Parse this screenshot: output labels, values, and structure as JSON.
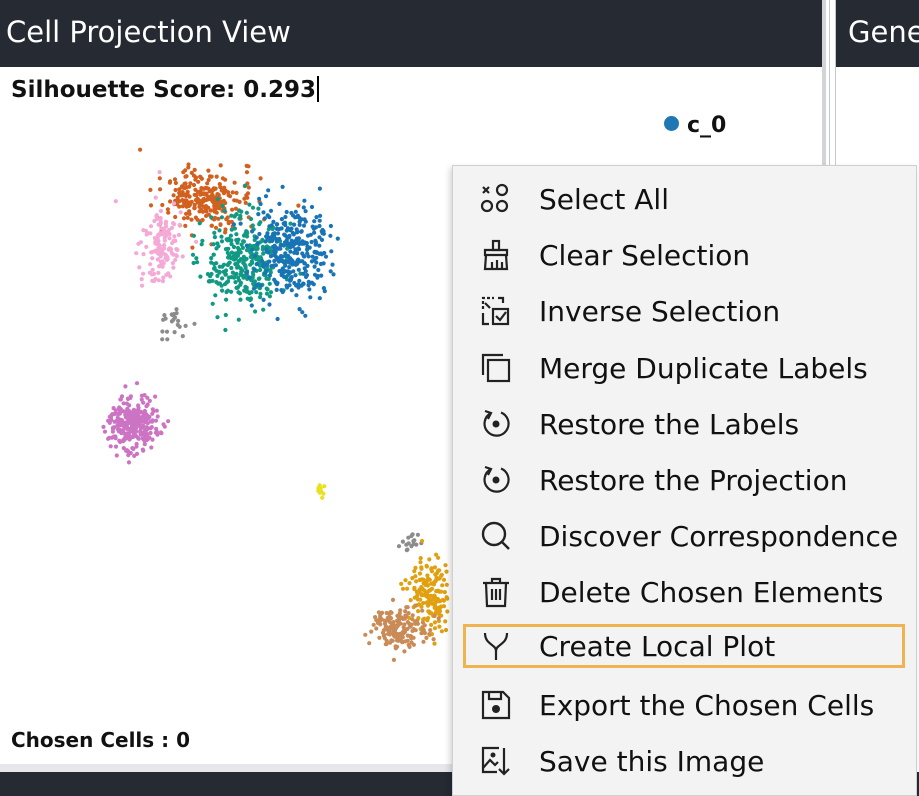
{
  "panels": {
    "left_title": "Cell Projection View",
    "right_title": "Gene"
  },
  "projection": {
    "silhouette_label": "Silhouette Score: 0.293",
    "chosen_cells_label": "Chosen Cells : 0",
    "legend": [
      {
        "label": "c_0",
        "color": "#1f77b4"
      }
    ]
  },
  "clusters": [
    {
      "name": "orange",
      "color": "#d2601f"
    },
    {
      "name": "pink",
      "color": "#f4a9d6"
    },
    {
      "name": "green",
      "color": "#109983"
    },
    {
      "name": "blue",
      "color": "#1874b5"
    },
    {
      "name": "gray",
      "color": "#8c8c8c"
    },
    {
      "name": "purple",
      "color": "#cc74c3"
    },
    {
      "name": "yellow",
      "color": "#e8e21e"
    },
    {
      "name": "gold",
      "color": "#e0a010"
    },
    {
      "name": "tan",
      "color": "#c98b57"
    }
  ],
  "context_menu": {
    "items": [
      {
        "label": "Select All",
        "icon": "select-all-icon"
      },
      {
        "label": "Clear Selection",
        "icon": "broom-icon"
      },
      {
        "label": "Inverse Selection",
        "icon": "inverse-selection-icon"
      },
      {
        "label": "Merge Duplicate Labels",
        "icon": "merge-icon"
      },
      {
        "label": "Restore the Labels",
        "icon": "restore-icon"
      },
      {
        "label": "Restore the Projection",
        "icon": "restore-icon"
      },
      {
        "label": "Discover Correspondence",
        "icon": "search-icon"
      },
      {
        "label": "Delete Chosen Elements",
        "icon": "trash-icon"
      },
      {
        "label": "Create Local Plot",
        "icon": "branch-icon",
        "highlighted": true
      },
      {
        "label": "Export the Chosen Cells",
        "icon": "save-icon"
      },
      {
        "label": "Save this Image",
        "icon": "save-image-icon"
      }
    ]
  }
}
